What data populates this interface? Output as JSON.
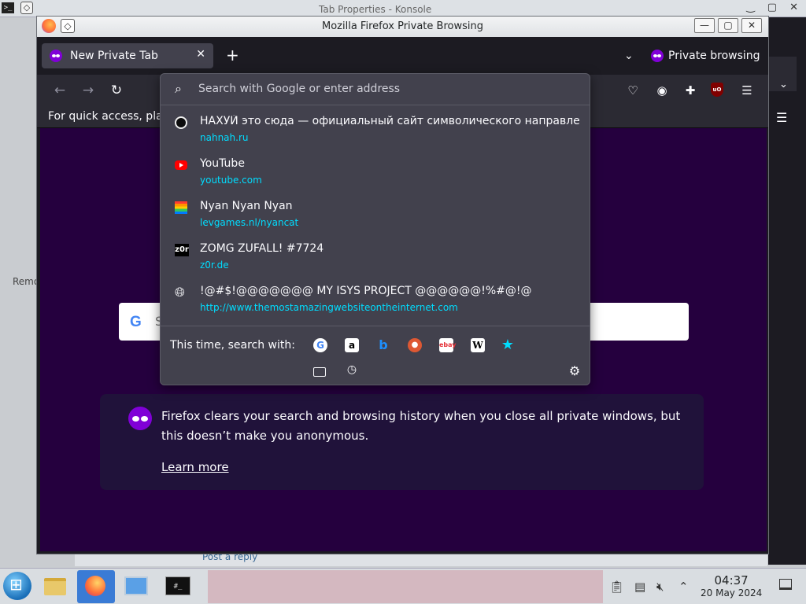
{
  "background": {
    "konsole_title": "Tab Properties - Konsole",
    "side_text": "Remo",
    "bottom_link": "Post a reply"
  },
  "window": {
    "title": "Mozilla Firefox Private Browsing",
    "min_label": "—",
    "max_label": "▢",
    "close_label": "✕"
  },
  "tabs": [
    {
      "label": "New Private Tab"
    }
  ],
  "tabstrip": {
    "new_tab_label": "+",
    "private_indicator": "Private browsing"
  },
  "bookmarks_bar": {
    "text": "For quick access, plac"
  },
  "urlbar": {
    "placeholder": "Search with Google or enter address",
    "results": [
      {
        "title": "НАХУЙ это сюда — официальный сайт символического направления",
        "url": "nahnah.ru",
        "icon": "site-dark-icon"
      },
      {
        "title": "YouTube",
        "url": "youtube.com",
        "icon": "youtube-icon"
      },
      {
        "title": "Nyan Nyan Nyan",
        "url": "levgames.nl/nyancat",
        "icon": "nyancat-icon"
      },
      {
        "title": "ZOMG ZUFALL! #7724",
        "url": "z0r.de",
        "icon": "z0r-icon"
      },
      {
        "title": "!@#$!@@@@@@@ MY ISYS PROJECT @@@@@@!%#@!@",
        "url": "http://www.themostamazingwebsiteontheinternet.com",
        "icon": "globe-icon"
      }
    ],
    "search_with_label": "This time, search with:",
    "engines": [
      "google-icon",
      "amazon-icon",
      "bing-icon",
      "duckduckgo-icon",
      "ebay-icon",
      "wikipedia-icon",
      "bookmark-star-icon"
    ]
  },
  "private_page": {
    "search_hint": "S",
    "message": "Firefox clears your search and browsing history when you close all private windows, but this doesn’t make you anonymous.",
    "learn_more": "Learn more"
  },
  "taskbar": {
    "time": "04:37",
    "date": "20 May 2024"
  },
  "colors": {
    "private_bg": "#25003e",
    "toolbar": "#2b2a33",
    "dropdown": "#42414d",
    "link": "#00ddff",
    "private_purple": "#8000d7"
  }
}
